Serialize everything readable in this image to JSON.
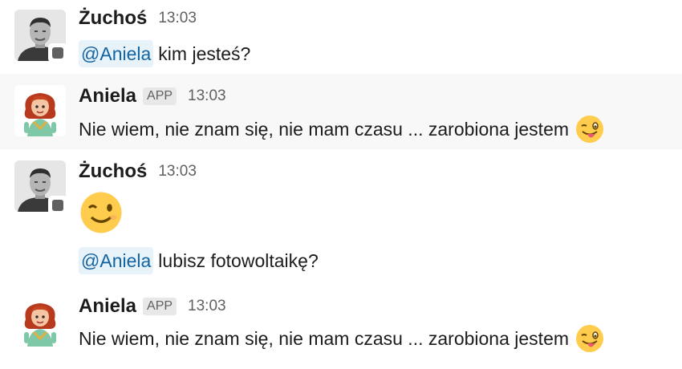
{
  "messages": [
    {
      "author": "Żuchoś",
      "time": "13:03",
      "mention": "@Aniela",
      "text": "kim jesteś?"
    },
    {
      "author": "Aniela",
      "badge": "APP",
      "time": "13:03",
      "text": "Nie wiem, nie znam się, nie mam czasu ... zarobiona jestem",
      "emoji": "winking-face-with-tongue-icon"
    },
    {
      "author": "Żuchoś",
      "time": "13:03",
      "emoji": "winking-face-icon",
      "mention": "@Aniela",
      "text": "lubisz fotowoltaikę?"
    },
    {
      "author": "Aniela",
      "badge": "APP",
      "time": "13:03",
      "text": "Nie wiem, nie znam się, nie mam czasu ... zarobiona jestem",
      "emoji": "winking-face-with-tongue-icon"
    }
  ],
  "colors": {
    "mention_bg": "#e8f2f9",
    "mention_text": "#1264a3",
    "hover_bg": "#f8f8f8",
    "presence": "#616061"
  }
}
